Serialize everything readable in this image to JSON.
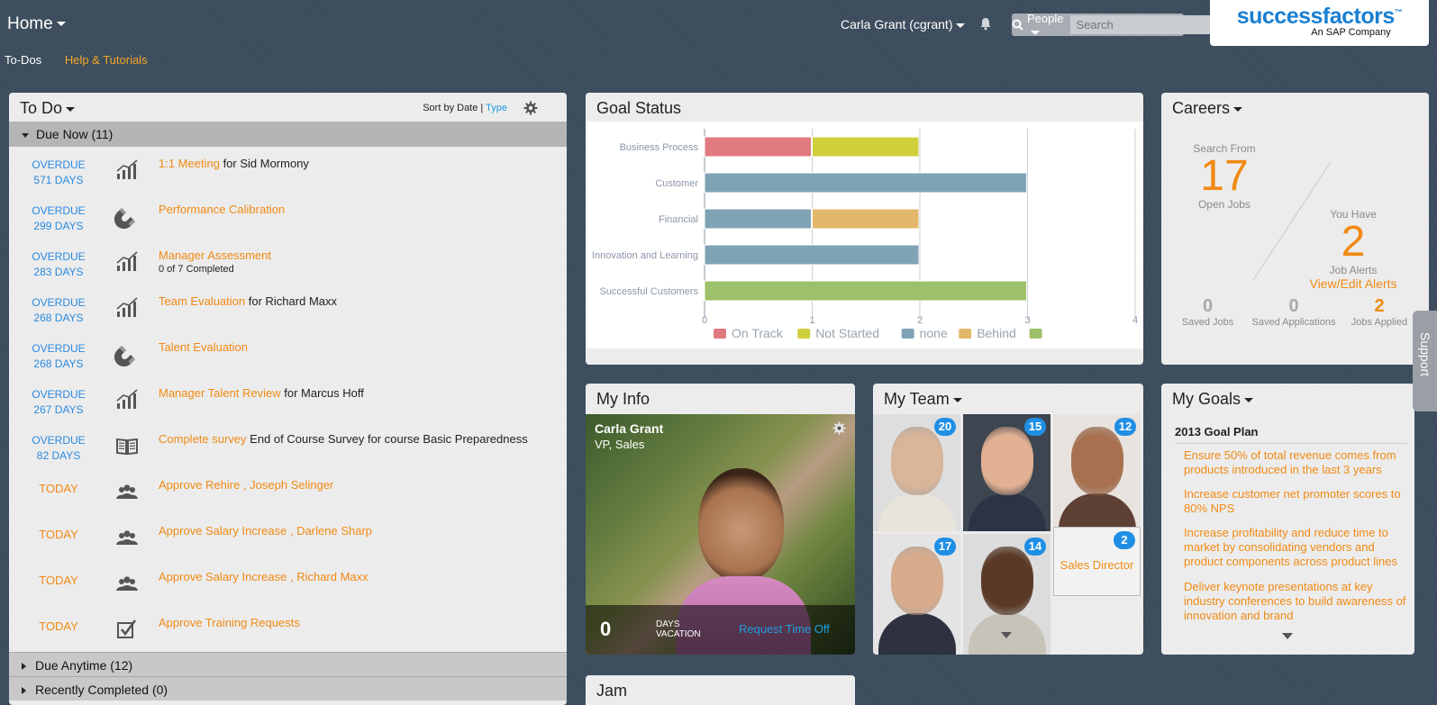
{
  "header": {
    "home_label": "Home",
    "subnav": {
      "todos": "To-Dos",
      "help": "Help & Tutorials"
    },
    "user": "Carla Grant (cgrant)",
    "search": {
      "scope": "People",
      "placeholder": "Search"
    },
    "logo": {
      "brand": "successfactors",
      "tm": "™",
      "tagline": "An SAP Company"
    }
  },
  "todo": {
    "title": "To Do",
    "sort_prefix": "Sort by Date",
    "sort_sep": "|",
    "sort_type": "Type",
    "due_now": "Due Now (11)",
    "items": [
      {
        "due1": "OVERDUE",
        "due2": "571 DAYS",
        "icon": "chart-icon",
        "link": "1:1 Meeting",
        "rest": "for Sid Mormony",
        "sub": ""
      },
      {
        "due1": "OVERDUE",
        "due2": "299 DAYS",
        "icon": "magnet-icon",
        "link": "Performance Calibration",
        "rest": "",
        "sub": ""
      },
      {
        "due1": "OVERDUE",
        "due2": "283 DAYS",
        "icon": "chart-icon",
        "link": "Manager Assessment",
        "rest": "",
        "sub": "0 of 7 Completed"
      },
      {
        "due1": "OVERDUE",
        "due2": "268 DAYS",
        "icon": "chart-icon",
        "link": "Team Evaluation",
        "rest": "for Richard Maxx",
        "sub": ""
      },
      {
        "due1": "OVERDUE",
        "due2": "268 DAYS",
        "icon": "magnet-icon",
        "link": "Talent Evaluation",
        "rest": "",
        "sub": ""
      },
      {
        "due1": "OVERDUE",
        "due2": "267 DAYS",
        "icon": "chart-icon",
        "link": "Manager Talent Review",
        "rest": "for Marcus Hoff",
        "sub": ""
      },
      {
        "due1": "OVERDUE",
        "due2": "82 DAYS",
        "icon": "book-icon",
        "link": "Complete survey",
        "rest": "End of Course Survey for course Basic Preparedness",
        "sub": ""
      },
      {
        "due1": "TODAY",
        "due2": "",
        "icon": "people-icon",
        "link": "Approve Rehire , Joseph Selinger",
        "rest": "",
        "sub": ""
      },
      {
        "due1": "TODAY",
        "due2": "",
        "icon": "people-icon",
        "link": "Approve Salary Increase , Darlene Sharp",
        "rest": "",
        "sub": ""
      },
      {
        "due1": "TODAY",
        "due2": "",
        "icon": "people-icon",
        "link": "Approve Salary Increase , Richard Maxx",
        "rest": "",
        "sub": ""
      },
      {
        "due1": "TODAY",
        "due2": "",
        "icon": "checkbox-icon",
        "link": "Approve Training Requests",
        "rest": "",
        "sub": ""
      }
    ],
    "due_anytime": "Due Anytime (12)",
    "recently_completed": "Recently Completed (0)"
  },
  "goal_status": {
    "title": "Goal Status"
  },
  "chart_data": {
    "type": "bar",
    "orientation": "horizontal",
    "stacked": true,
    "categories": [
      "Business Process",
      "Customer",
      "Financial",
      "Innovation and Learning",
      "Successful Customers"
    ],
    "series": [
      {
        "name": "On Track",
        "color": "#e07a80",
        "values": [
          1,
          0,
          0,
          0,
          0
        ]
      },
      {
        "name": "Not Started",
        "color": "#cfcf3c",
        "values": [
          1,
          0,
          0,
          0,
          0
        ]
      },
      {
        "name": "none",
        "color": "#7fa3b5",
        "values": [
          0,
          3,
          1,
          2,
          0
        ]
      },
      {
        "name": "Behind",
        "color": "#e4b86a",
        "values": [
          0,
          0,
          1,
          0,
          0
        ]
      },
      {
        "name": "",
        "color": "#9dc06a",
        "values": [
          0,
          0,
          0,
          0,
          3
        ]
      }
    ],
    "xlim": [
      0,
      4
    ],
    "xticks": [
      "0",
      "1",
      "2",
      "3",
      "4"
    ],
    "grid": true,
    "legend": "bottom"
  },
  "careers": {
    "title": "Careers",
    "search_from": "Search From",
    "open_jobs_count": "17",
    "open_jobs": "Open Jobs",
    "you_have": "You Have",
    "alerts_count": "2",
    "job_alerts": "Job Alerts",
    "view_edit": "View/Edit Alerts",
    "saved_jobs_count": "0",
    "saved_jobs": "Saved Jobs",
    "saved_apps_count": "0",
    "saved_apps": "Saved Applications",
    "applied_count": "2",
    "applied": "Jobs Applied"
  },
  "myinfo": {
    "title": "My Info",
    "name": "Carla Grant",
    "role": "VP, Sales",
    "vacation_days": "0",
    "vacation_l1": "DAYS",
    "vacation_l2": "VACATION",
    "request": "Request Time Off"
  },
  "myteam": {
    "title": "My Team",
    "members": [
      {
        "badge": "20",
        "skin": "#d9b59a",
        "suit": "#e8e4dc",
        "bg": "#dedede"
      },
      {
        "badge": "15",
        "skin": "#e2b194",
        "suit": "#2b3444",
        "bg": "#3c4550"
      },
      {
        "badge": "12",
        "skin": "#a8704e",
        "suit": "#5e4034",
        "bg": "#e8e3de"
      },
      {
        "badge": "17",
        "skin": "#d7ab8c",
        "suit": "#2d3140",
        "bg": "#e4e4e4"
      },
      {
        "badge": "14",
        "skin": "#5a3a26",
        "suit": "#c8c3b8",
        "bg": "#dcdcdc"
      }
    ],
    "director_badge": "2",
    "director_label": "Sales Director"
  },
  "mygoals": {
    "title": "My Goals",
    "plan": "2013 Goal Plan",
    "goals": [
      "Ensure 50% of total revenue comes from products introduced in the last 3 years",
      "Increase customer net promoter scores to 80% NPS",
      "Increase profitability and reduce time to market by consolidating vendors and product components across product lines",
      "Deliver keynote presentations at key industry conferences to build awareness of innovation and brand"
    ]
  },
  "jam": {
    "title": "Jam"
  },
  "support": {
    "label": "Support"
  }
}
